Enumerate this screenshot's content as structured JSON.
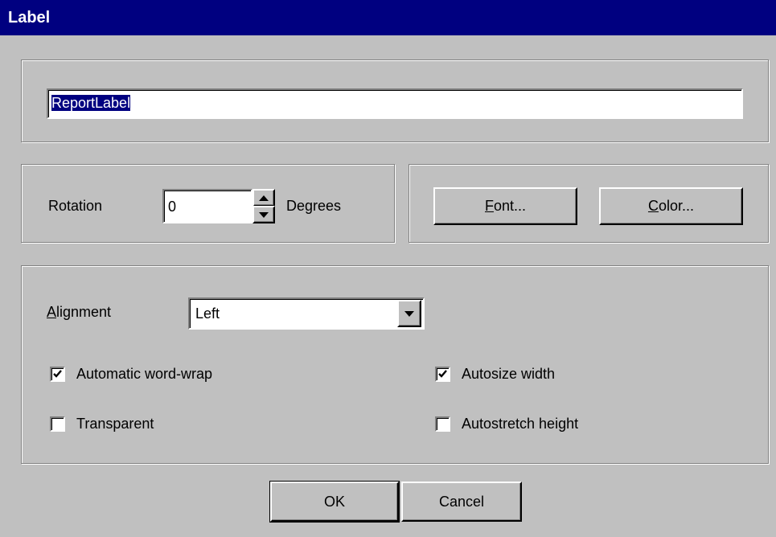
{
  "window": {
    "title": "Label"
  },
  "name_field": {
    "value": "ReportLabel"
  },
  "rotation": {
    "label": "Rotation",
    "value": "0",
    "unit": "Degrees"
  },
  "buttons": {
    "font": {
      "mnemonic": "F",
      "rest": "ont..."
    },
    "color": {
      "mnemonic": "C",
      "rest": "olor..."
    },
    "ok": "OK",
    "cancel": "Cancel"
  },
  "alignment": {
    "mnemonic": "A",
    "rest": "lignment",
    "value": "Left"
  },
  "checkboxes": {
    "word_wrap": {
      "label": "Automatic word-wrap",
      "checked": true
    },
    "transparent": {
      "label": "Transparent",
      "checked": false
    },
    "autosize_width": {
      "label": "Autosize width",
      "checked": true
    },
    "autostretch_height": {
      "label": "Autostretch height",
      "checked": false
    }
  }
}
